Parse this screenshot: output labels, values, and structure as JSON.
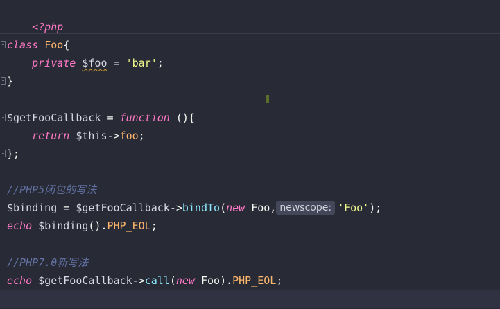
{
  "editor": {
    "lines": {
      "php_open": "<?php",
      "class_kw": "class",
      "class_name": "Foo",
      "class_brace": "{",
      "private_kw": "private",
      "prop_var": "$foo",
      "prop_eq": " = ",
      "prop_val": "'bar'",
      "prop_semi": ";",
      "class_close": "}",
      "cb_var": "$getFooCallback",
      "cb_eq": " = ",
      "cb_function_kw": "function",
      "cb_sig": " (){",
      "return_kw": "return",
      "this_var": " $this",
      "arrow1": "->",
      "this_prop": "foo",
      "return_semi": ";",
      "cb_close": "};",
      "comment1": "//PHP5闭包的写法",
      "binding_var": "$binding",
      "binding_eq": " = ",
      "binding_src": "$getFooCallback",
      "arrow2": "->",
      "bind_fn": "bindTo",
      "bind_open": "(",
      "new_kw1": "new",
      "foo_cls1": " Foo,",
      "param_hint": "newscope:",
      "bind_arg": "'Foo'",
      "bind_close": ");",
      "echo_kw1": "echo",
      "echo_var1": " $binding",
      "echo_call1": "().",
      "eol1": "PHP_EOL",
      "echo_semi1": ";",
      "comment2": "//PHP7.0新写法",
      "echo_kw2": "echo",
      "echo_var2": " $getFooCallback",
      "arrow3": "->",
      "call_fn": "call",
      "call_open": "(",
      "new_kw2": "new",
      "foo_cls2": " Foo",
      "call_close": ").",
      "eol2": "PHP_EOL",
      "echo_semi2": ";"
    }
  },
  "colors": {
    "background": "#282a36",
    "keyword": "#ff79c6",
    "string": "#f1fa8c",
    "function": "#8be9fd",
    "constant": "#ffb86c",
    "comment": "#6272a4"
  }
}
